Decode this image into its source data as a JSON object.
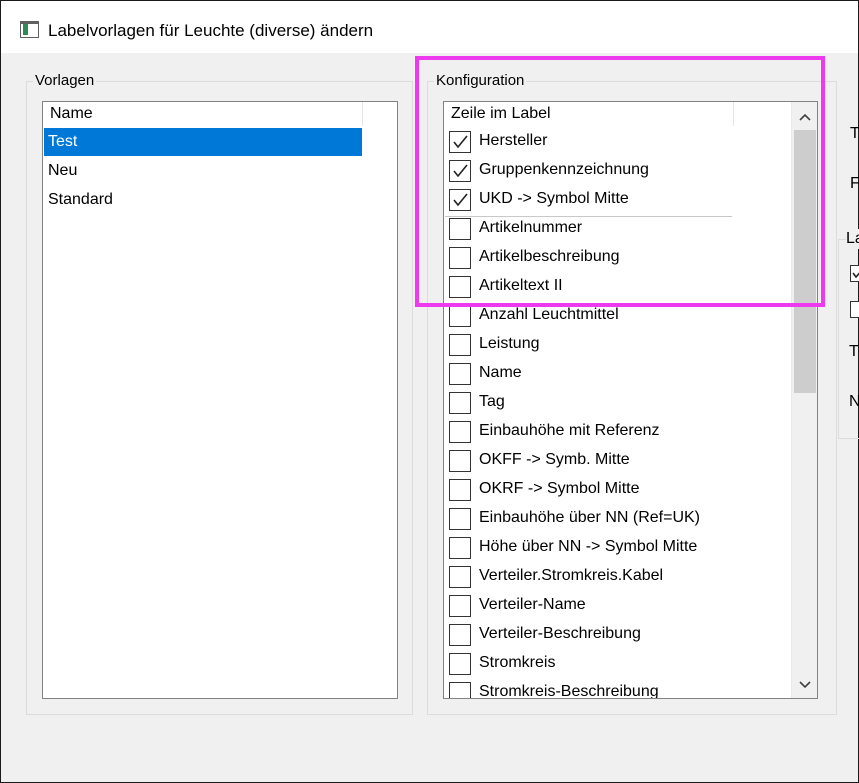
{
  "window": {
    "title": "Labelvorlagen für Leuchte (diverse) ändern",
    "icon": "app-window-icon"
  },
  "vorlagen": {
    "group_label": "Vorlagen",
    "column_header": "Name",
    "items": [
      {
        "label": "Test",
        "selected": true
      },
      {
        "label": "Neu",
        "selected": false
      },
      {
        "label": "Standard",
        "selected": false
      }
    ]
  },
  "konfiguration": {
    "group_label": "Konfiguration",
    "column_header": "Zeile im Label",
    "items": [
      {
        "label": "Hersteller",
        "checked": true
      },
      {
        "label": "Gruppenkennzeichnung",
        "checked": true
      },
      {
        "label": "UKD -> Symbol Mitte",
        "checked": true
      },
      {
        "label": "Artikelnummer",
        "checked": false
      },
      {
        "label": "Artikelbeschreibung",
        "checked": false
      },
      {
        "label": "Artikeltext II",
        "checked": false
      },
      {
        "label": "Anzahl Leuchtmittel",
        "checked": false
      },
      {
        "label": "Leistung",
        "checked": false
      },
      {
        "label": "Name",
        "checked": false
      },
      {
        "label": "Tag",
        "checked": false
      },
      {
        "label": "Einbauhöhe mit Referenz",
        "checked": false
      },
      {
        "label": "OKFF -> Symb. Mitte",
        "checked": false
      },
      {
        "label": "OKRF -> Symbol Mitte",
        "checked": false
      },
      {
        "label": "Einbauhöhe über NN (Ref=UK)",
        "checked": false
      },
      {
        "label": "Höhe über NN -> Symbol Mitte",
        "checked": false
      },
      {
        "label": "Verteiler.Stromkreis.Kabel",
        "checked": false
      },
      {
        "label": "Verteiler-Name",
        "checked": false
      },
      {
        "label": "Verteiler-Beschreibung",
        "checked": false
      },
      {
        "label": "Stromkreis",
        "checked": false
      },
      {
        "label": "Stromkreis-Beschreibung",
        "checked": false
      }
    ]
  },
  "right_panel": {
    "clipped_text": [
      "T",
      "F",
      "La",
      "T",
      "N"
    ],
    "clipped_checkboxes": [
      true,
      false
    ]
  },
  "colors": {
    "selection": "#0078d7",
    "highlight_annotation": "#ee3aee",
    "window_bg": "#f0f0f0"
  }
}
